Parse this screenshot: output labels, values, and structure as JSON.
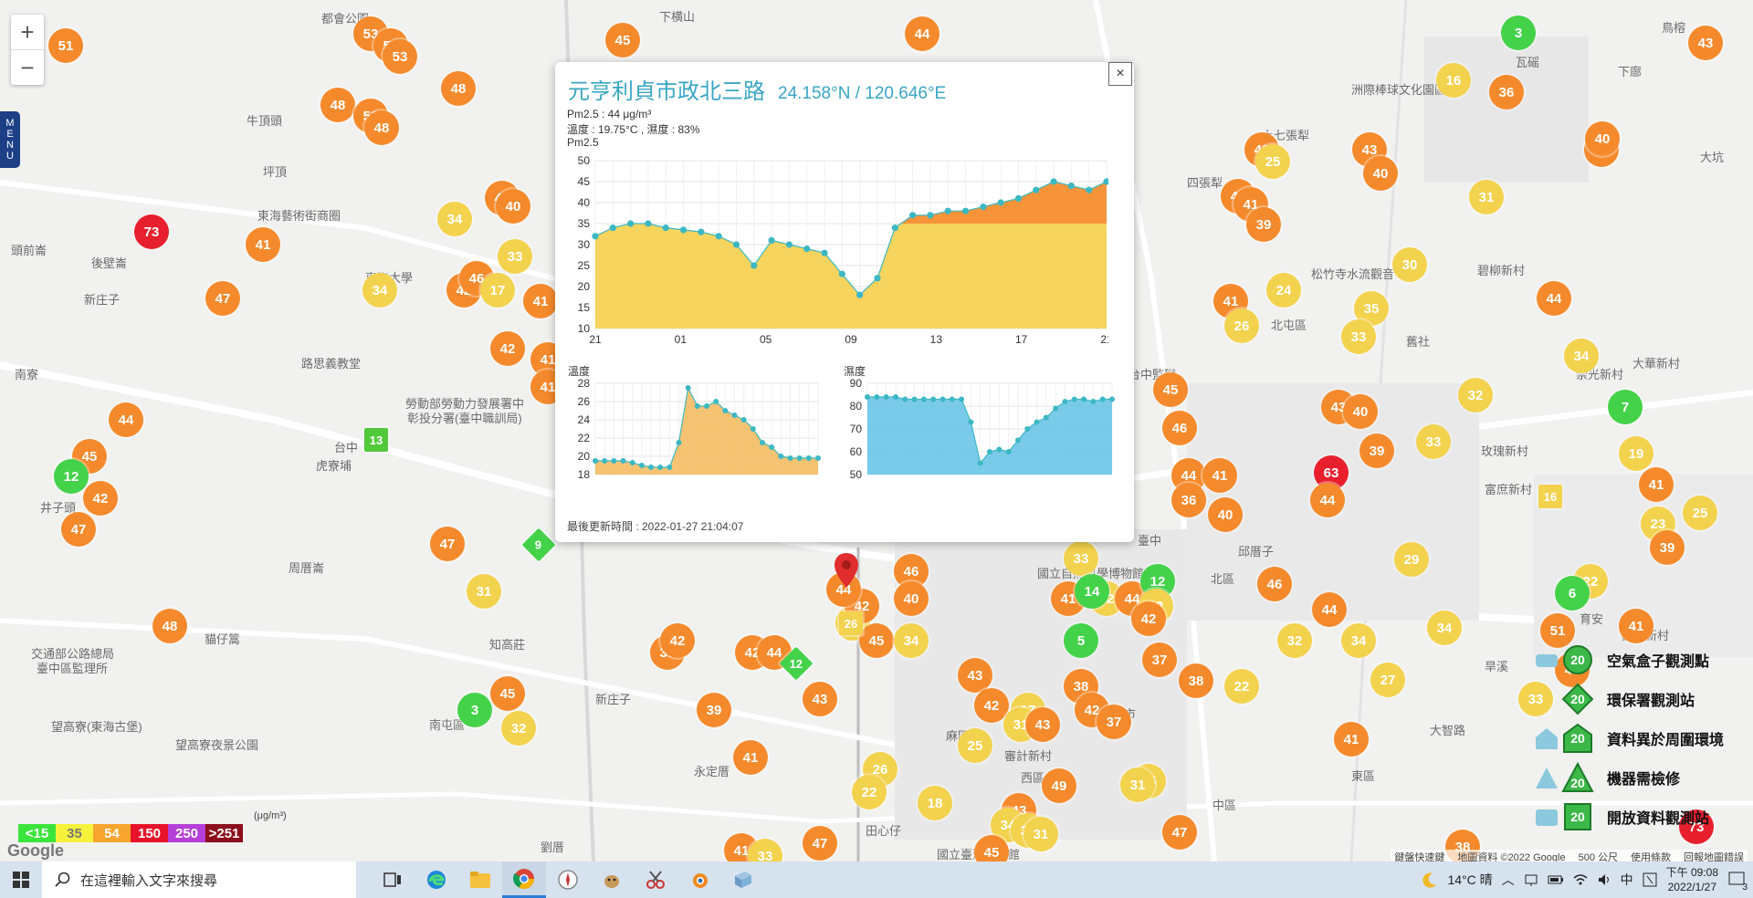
{
  "map": {
    "zoom_in": "+",
    "zoom_out": "−",
    "menu_label": [
      "M",
      "E",
      "N",
      "U"
    ],
    "places": [
      {
        "t": "都會公園",
        "x": 352,
        "y": 10
      },
      {
        "t": "下横山",
        "x": 722,
        "y": 8
      },
      {
        "t": "牛頂頭",
        "x": 270,
        "y": 122
      },
      {
        "t": "坪頂",
        "x": 288,
        "y": 178
      },
      {
        "t": "東海藝術街商圈",
        "x": 282,
        "y": 226
      },
      {
        "t": "後壁崙",
        "x": 100,
        "y": 278
      },
      {
        "t": "頭前崙",
        "x": 12,
        "y": 264
      },
      {
        "t": "新庄子",
        "x": 92,
        "y": 318
      },
      {
        "t": "南寮",
        "x": 16,
        "y": 400
      },
      {
        "t": "路思義教堂",
        "x": 330,
        "y": 388
      },
      {
        "t": "東海大學",
        "x": 400,
        "y": 294
      },
      {
        "t": "台中",
        "x": 366,
        "y": 480
      },
      {
        "t": "虎寮埔",
        "x": 346,
        "y": 500
      },
      {
        "t": "井子頭",
        "x": 44,
        "y": 546
      },
      {
        "t": "周厝崙",
        "x": 316,
        "y": 612
      },
      {
        "t": "交通部公路總局",
        "x": 34,
        "y": 706
      },
      {
        "t": "臺中區監理所",
        "x": 40,
        "y": 722
      },
      {
        "t": "貓仔篙",
        "x": 224,
        "y": 690
      },
      {
        "t": "望高寮(東海古堡)",
        "x": 56,
        "y": 786
      },
      {
        "t": "望高寮夜景公園",
        "x": 192,
        "y": 806
      },
      {
        "t": "知高莊",
        "x": 536,
        "y": 696
      },
      {
        "t": "新庄子",
        "x": 652,
        "y": 756
      },
      {
        "t": "永定厝",
        "x": 760,
        "y": 835
      },
      {
        "t": "南屯區",
        "x": 470,
        "y": 784
      },
      {
        "t": "上七張犁",
        "x": 1382,
        "y": 138
      },
      {
        "t": "四張犁",
        "x": 1300,
        "y": 190
      },
      {
        "t": "北屯區",
        "x": 1392,
        "y": 346
      },
      {
        "t": "洲際棒球文化園區",
        "x": 1480,
        "y": 88
      },
      {
        "t": "瓦磘",
        "x": 1660,
        "y": 58
      },
      {
        "t": "鳥榕",
        "x": 1820,
        "y": 20
      },
      {
        "t": "大坑",
        "x": 1862,
        "y": 162
      },
      {
        "t": "下廍",
        "x": 1772,
        "y": 68
      },
      {
        "t": "松竹寺水流觀音",
        "x": 1436,
        "y": 290
      },
      {
        "t": "碧柳新村",
        "x": 1618,
        "y": 286
      },
      {
        "t": "舊社",
        "x": 1540,
        "y": 364
      },
      {
        "t": "玫瑰新村",
        "x": 1622,
        "y": 484
      },
      {
        "t": "大華新村",
        "x": 1788,
        "y": 388
      },
      {
        "t": "崇光新村",
        "x": 1726,
        "y": 400
      },
      {
        "t": "富庶新村",
        "x": 1626,
        "y": 526
      },
      {
        "t": "邱厝子",
        "x": 1356,
        "y": 594
      },
      {
        "t": "北區",
        "x": 1326,
        "y": 624
      },
      {
        "t": "臺中",
        "x": 1246,
        "y": 582
      },
      {
        "t": "國立自然科學博物館",
        "x": 1136,
        "y": 618
      },
      {
        "t": "中市",
        "x": 1218,
        "y": 772
      },
      {
        "t": "西區",
        "x": 1118,
        "y": 842
      },
      {
        "t": "麻園",
        "x": 1036,
        "y": 796
      },
      {
        "t": "審計新村",
        "x": 1100,
        "y": 818
      },
      {
        "t": "中區",
        "x": 1328,
        "y": 872
      },
      {
        "t": "東區",
        "x": 1480,
        "y": 840
      },
      {
        "t": "田心仔",
        "x": 948,
        "y": 900
      },
      {
        "t": "台中監獄",
        "x": 1236,
        "y": 400
      },
      {
        "t": "分埔",
        "x": 1444,
        "y": 506
      },
      {
        "t": "育安",
        "x": 1730,
        "y": 668
      },
      {
        "t": "田園新村",
        "x": 1776,
        "y": 686
      },
      {
        "t": "旱溪",
        "x": 1626,
        "y": 720
      },
      {
        "t": "大智路",
        "x": 1566,
        "y": 790
      },
      {
        "t": "勞動部勞動力發展署中",
        "x": 444,
        "y": 432
      },
      {
        "t": "彰投分署(臺中職訓局)",
        "x": 446,
        "y": 448
      },
      {
        "t": "國立臺灣美術館",
        "x": 1026,
        "y": 926
      },
      {
        "t": "劉厝",
        "x": 592,
        "y": 918
      }
    ],
    "markers": [
      {
        "v": "51",
        "x": 72,
        "y": 50
      },
      {
        "v": "53",
        "x": 406,
        "y": 37
      },
      {
        "v": "50",
        "x": 428,
        "y": 50
      },
      {
        "v": "53",
        "x": 438,
        "y": 62
      },
      {
        "v": "48",
        "x": 502,
        "y": 97
      },
      {
        "v": "48",
        "x": 370,
        "y": 115
      },
      {
        "v": "51",
        "x": 406,
        "y": 127
      },
      {
        "v": "48",
        "x": 418,
        "y": 140
      },
      {
        "v": "45",
        "x": 682,
        "y": 44
      },
      {
        "v": "44",
        "x": 1010,
        "y": 37
      },
      {
        "v": "3",
        "x": 1663,
        "y": 36
      },
      {
        "v": "43",
        "x": 1868,
        "y": 47
      },
      {
        "v": "16",
        "x": 1592,
        "y": 88
      },
      {
        "v": "36",
        "x": 1650,
        "y": 101
      },
      {
        "v": "73",
        "x": 166,
        "y": 254
      },
      {
        "v": "41",
        "x": 288,
        "y": 268
      },
      {
        "v": "47",
        "x": 550,
        "y": 217
      },
      {
        "v": "40",
        "x": 562,
        "y": 226
      },
      {
        "v": "34",
        "x": 498,
        "y": 240
      },
      {
        "v": "33",
        "x": 564,
        "y": 281
      },
      {
        "v": "34",
        "x": 416,
        "y": 318
      },
      {
        "v": "42",
        "x": 508,
        "y": 318
      },
      {
        "v": "46",
        "x": 522,
        "y": 305
      },
      {
        "v": "17",
        "x": 545,
        "y": 318
      },
      {
        "v": "41",
        "x": 592,
        "y": 330
      },
      {
        "v": "47",
        "x": 244,
        "y": 327
      },
      {
        "v": "42",
        "x": 556,
        "y": 382
      },
      {
        "v": "41",
        "x": 600,
        "y": 394
      },
      {
        "v": "41",
        "x": 600,
        "y": 424
      },
      {
        "v": "44",
        "x": 138,
        "y": 460
      },
      {
        "v": "45",
        "x": 98,
        "y": 500
      },
      {
        "v": "12",
        "x": 78,
        "y": 522
      },
      {
        "v": "42",
        "x": 110,
        "y": 546
      },
      {
        "v": "47",
        "x": 86,
        "y": 580
      },
      {
        "v": "47",
        "x": 490,
        "y": 596
      },
      {
        "v": "31",
        "x": 530,
        "y": 648
      },
      {
        "v": "48",
        "x": 186,
        "y": 686
      },
      {
        "v": "45",
        "x": 556,
        "y": 760
      },
      {
        "v": "3",
        "x": 520,
        "y": 778
      },
      {
        "v": "32",
        "x": 568,
        "y": 798
      },
      {
        "v": "40",
        "x": 1382,
        "y": 164
      },
      {
        "v": "25",
        "x": 1394,
        "y": 177
      },
      {
        "v": "43",
        "x": 1500,
        "y": 164
      },
      {
        "v": "40",
        "x": 1512,
        "y": 190
      },
      {
        "v": "44",
        "x": 1754,
        "y": 164
      },
      {
        "v": "40",
        "x": 1755,
        "y": 152
      },
      {
        "v": "42",
        "x": 1356,
        "y": 215
      },
      {
        "v": "41",
        "x": 1370,
        "y": 224
      },
      {
        "v": "39",
        "x": 1384,
        "y": 246
      },
      {
        "v": "31",
        "x": 1628,
        "y": 216
      },
      {
        "v": "30",
        "x": 1544,
        "y": 290
      },
      {
        "v": "24",
        "x": 1406,
        "y": 318
      },
      {
        "v": "41",
        "x": 1348,
        "y": 330
      },
      {
        "v": "26",
        "x": 1360,
        "y": 357
      },
      {
        "v": "35",
        "x": 1502,
        "y": 338
      },
      {
        "v": "33",
        "x": 1488,
        "y": 369
      },
      {
        "v": "44",
        "x": 1702,
        "y": 327
      },
      {
        "v": "34",
        "x": 1732,
        "y": 390
      },
      {
        "v": "45",
        "x": 1282,
        "y": 427
      },
      {
        "v": "46",
        "x": 1292,
        "y": 469
      },
      {
        "v": "32",
        "x": 1616,
        "y": 433
      },
      {
        "v": "7",
        "x": 1780,
        "y": 446
      },
      {
        "v": "43",
        "x": 1466,
        "y": 446
      },
      {
        "v": "40",
        "x": 1490,
        "y": 451
      },
      {
        "v": "33",
        "x": 1570,
        "y": 484
      },
      {
        "v": "39",
        "x": 1508,
        "y": 494
      },
      {
        "v": "19",
        "x": 1792,
        "y": 497
      },
      {
        "v": "63",
        "x": 1458,
        "y": 518
      },
      {
        "v": "44",
        "x": 1454,
        "y": 548
      },
      {
        "v": "44",
        "x": 1302,
        "y": 521
      },
      {
        "v": "41",
        "x": 1336,
        "y": 521
      },
      {
        "v": "36",
        "x": 1302,
        "y": 548
      },
      {
        "v": "40",
        "x": 1342,
        "y": 564
      },
      {
        "v": "41",
        "x": 1814,
        "y": 531
      },
      {
        "v": "25",
        "x": 1862,
        "y": 562
      },
      {
        "v": "23",
        "x": 1816,
        "y": 574
      },
      {
        "v": "39",
        "x": 1826,
        "y": 600
      },
      {
        "v": "29",
        "x": 1546,
        "y": 613
      },
      {
        "v": "22",
        "x": 1742,
        "y": 637
      },
      {
        "v": "6",
        "x": 1722,
        "y": 650
      },
      {
        "v": "33",
        "x": 1184,
        "y": 612
      },
      {
        "v": "46",
        "x": 998,
        "y": 626
      },
      {
        "v": "40",
        "x": 998,
        "y": 656
      },
      {
        "v": "26",
        "x": 934,
        "y": 683
      },
      {
        "v": "45",
        "x": 960,
        "y": 702
      },
      {
        "v": "34",
        "x": 998,
        "y": 702
      },
      {
        "v": "42",
        "x": 944,
        "y": 664
      },
      {
        "v": "41",
        "x": 1170,
        "y": 656
      },
      {
        "v": "32",
        "x": 1212,
        "y": 656
      },
      {
        "v": "14",
        "x": 1196,
        "y": 648
      },
      {
        "v": "44",
        "x": 1240,
        "y": 656
      },
      {
        "v": "12",
        "x": 1268,
        "y": 637
      },
      {
        "v": "22",
        "x": 1266,
        "y": 664
      },
      {
        "v": "42",
        "x": 1258,
        "y": 678
      },
      {
        "v": "46",
        "x": 1396,
        "y": 640
      },
      {
        "v": "44",
        "x": 1456,
        "y": 668
      },
      {
        "v": "5",
        "x": 1184,
        "y": 702
      },
      {
        "v": "37",
        "x": 1270,
        "y": 723
      },
      {
        "v": "32",
        "x": 1418,
        "y": 702
      },
      {
        "v": "34",
        "x": 1488,
        "y": 702
      },
      {
        "v": "34",
        "x": 1582,
        "y": 688
      },
      {
        "v": "51",
        "x": 1706,
        "y": 691
      },
      {
        "v": "41",
        "x": 1792,
        "y": 686
      },
      {
        "v": "38",
        "x": 731,
        "y": 715
      },
      {
        "v": "42",
        "x": 742,
        "y": 702
      },
      {
        "v": "42",
        "x": 824,
        "y": 715
      },
      {
        "v": "44",
        "x": 848,
        "y": 715
      },
      {
        "v": "43",
        "x": 898,
        "y": 766
      },
      {
        "v": "39",
        "x": 782,
        "y": 778
      },
      {
        "v": "43",
        "x": 1068,
        "y": 740
      },
      {
        "v": "38",
        "x": 1184,
        "y": 752
      },
      {
        "v": "38",
        "x": 1310,
        "y": 746
      },
      {
        "v": "22",
        "x": 1360,
        "y": 752
      },
      {
        "v": "27",
        "x": 1520,
        "y": 745
      },
      {
        "v": "42",
        "x": 1086,
        "y": 773
      },
      {
        "v": "17",
        "x": 1126,
        "y": 778
      },
      {
        "v": "42",
        "x": 1196,
        "y": 778
      },
      {
        "v": "37",
        "x": 1220,
        "y": 791
      },
      {
        "v": "31",
        "x": 1118,
        "y": 794
      },
      {
        "v": "43",
        "x": 1142,
        "y": 794
      },
      {
        "v": "41",
        "x": 1480,
        "y": 810
      },
      {
        "v": "25",
        "x": 1068,
        "y": 817
      },
      {
        "v": "45",
        "x": 1722,
        "y": 734
      },
      {
        "v": "33",
        "x": 1682,
        "y": 766
      },
      {
        "v": "41",
        "x": 822,
        "y": 830
      },
      {
        "v": "26",
        "x": 964,
        "y": 843
      },
      {
        "v": "22",
        "x": 952,
        "y": 868
      },
      {
        "v": "18",
        "x": 1024,
        "y": 880
      },
      {
        "v": "49",
        "x": 1160,
        "y": 861
      },
      {
        "v": "35",
        "x": 1258,
        "y": 856
      },
      {
        "v": "31",
        "x": 1246,
        "y": 860
      },
      {
        "v": "43",
        "x": 1116,
        "y": 888
      },
      {
        "v": "34",
        "x": 1104,
        "y": 904
      },
      {
        "v": "34",
        "x": 1126,
        "y": 910
      },
      {
        "v": "31",
        "x": 1140,
        "y": 914
      },
      {
        "v": "45",
        "x": 1086,
        "y": 934
      },
      {
        "v": "47",
        "x": 898,
        "y": 924
      },
      {
        "v": "47",
        "x": 1292,
        "y": 912
      },
      {
        "v": "41",
        "x": 812,
        "y": 932
      },
      {
        "v": "33",
        "x": 838,
        "y": 938
      },
      {
        "v": "73",
        "x": 1858,
        "y": 906
      },
      {
        "v": "38",
        "x": 1602,
        "y": 928
      },
      {
        "v": "44",
        "x": 924,
        "y": 646
      }
    ],
    "squares": [
      {
        "v": "13",
        "x": 412,
        "y": 482,
        "c": "#52c93a"
      },
      {
        "v": "16",
        "x": 1698,
        "y": 544,
        "c": "#f3d24e"
      },
      {
        "v": "26",
        "x": 932,
        "y": 683,
        "c": "#f3d24e"
      }
    ],
    "diamonds": [
      {
        "v": "9",
        "x": 590,
        "y": 597,
        "c": "#44d24a"
      },
      {
        "v": "12",
        "x": 872,
        "y": 727,
        "c": "#44d24a"
      }
    ]
  },
  "popup": {
    "title": "元亨利貞市政北三路",
    "coordinate": "24.158°N / 120.646°E",
    "pm_line": "Pm2.5 : 44 μg/m³",
    "temp_hum_line": "溫度 : 19.75°C , 濕度 : 83%",
    "pm_chart_label": "Pm2.5",
    "temp_chart_label": "溫度",
    "hum_chart_label": "濕度",
    "updated": "最後更新時間 : 2022-01-27 21:04:07",
    "close": "×"
  },
  "chart_data": [
    {
      "type": "area",
      "title": "Pm2.5",
      "x_tick_labels": [
        "21",
        "01",
        "05",
        "09",
        "13",
        "17",
        "21"
      ],
      "ylim": [
        10,
        50
      ],
      "yticks": [
        10,
        15,
        20,
        25,
        30,
        35,
        40,
        45,
        50
      ],
      "threshold": 35,
      "colors": {
        "below": "#f6d45e",
        "above": "#f7943a",
        "points": "#3cb8c3"
      },
      "values": [
        32,
        34,
        35,
        35,
        34,
        33.5,
        33,
        32,
        30,
        25,
        31,
        30,
        29,
        28,
        23,
        18,
        22,
        34,
        37,
        37,
        38,
        38,
        39,
        40,
        41,
        43,
        45,
        44,
        43,
        45
      ]
    },
    {
      "type": "area",
      "title": "溫度",
      "ylim": [
        18,
        28
      ],
      "yticks": [
        18,
        20,
        22,
        24,
        26,
        28
      ],
      "colors": {
        "fill": "#f5b85a",
        "points": "#3cb8c3"
      },
      "values": [
        19.5,
        19.5,
        19.5,
        19.5,
        19.3,
        19.0,
        18.8,
        18.8,
        18.8,
        21.5,
        27.5,
        25.5,
        25.5,
        26,
        25,
        24.5,
        24,
        23,
        21.5,
        21,
        20,
        19.8,
        19.8,
        19.8,
        19.8
      ]
    },
    {
      "type": "area",
      "title": "濕度",
      "ylim": [
        50,
        90
      ],
      "yticks": [
        50,
        60,
        70,
        80,
        90
      ],
      "colors": {
        "fill": "#63c1e6",
        "points": "#3cb8c3"
      },
      "values": [
        84,
        84,
        84,
        84,
        83,
        83,
        83,
        83,
        83,
        83,
        83,
        73,
        55,
        60,
        61,
        60,
        65,
        70,
        73,
        75,
        79,
        82,
        83,
        83,
        82,
        83,
        83
      ]
    }
  ],
  "legend_scale": {
    "unit": "(μg/m³)",
    "items": [
      {
        "label": "<15",
        "color": "#3be43b"
      },
      {
        "label": "35",
        "color": "#f6f23c"
      },
      {
        "label": "54",
        "color": "#f7a52e"
      },
      {
        "label": "150",
        "color": "#e8132a"
      },
      {
        "label": "250",
        "color": "#b53fd7"
      },
      {
        "label": ">251",
        "color": "#8b0f1d"
      }
    ]
  },
  "marker_legend": [
    {
      "label": "空氣盒子觀測點",
      "shape": "circle"
    },
    {
      "label": "環保署觀測站",
      "shape": "diamond"
    },
    {
      "label": "資料異於周圍環境",
      "shape": "house"
    },
    {
      "label": "機器需檢修",
      "shape": "triangle"
    },
    {
      "label": "開放資料觀測站",
      "shape": "square"
    }
  ],
  "marker_legend_value": "20",
  "google_logo": "Google",
  "attribution": [
    "鍵盤快速鍵",
    "地圖資料 ©2022 Google",
    "500 公尺",
    "使用條款",
    "回報地圖錯誤"
  ],
  "taskbar": {
    "search_placeholder": "在這裡輸入文字來搜尋",
    "weather": "14°C 晴",
    "ime": "中",
    "time": "下午 09:08",
    "date": "2022/1/27",
    "notification_count": "3"
  },
  "colors": {
    "orange": "#f58a2c",
    "yellow": "#f3d24e",
    "green": "#44d24a",
    "red": "#e8202e",
    "accent": "#3aa6c6"
  }
}
